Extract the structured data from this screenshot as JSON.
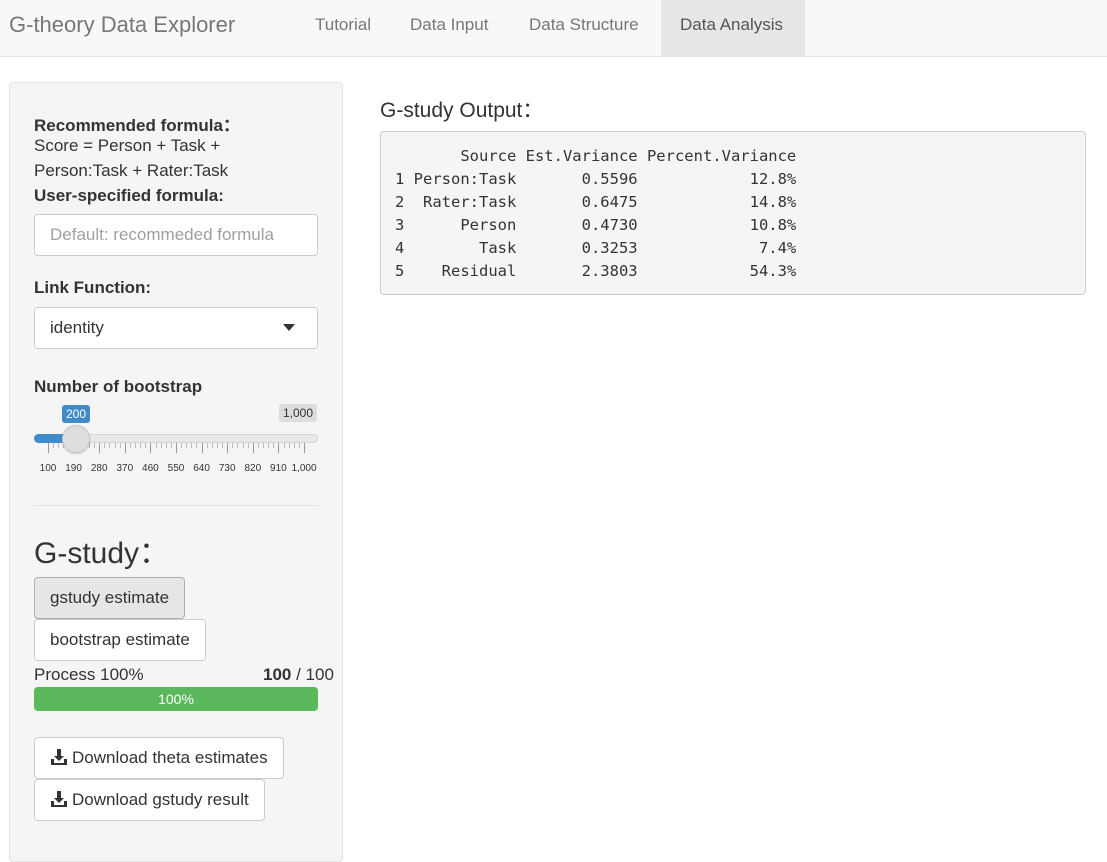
{
  "app": {
    "title": "G-theory Data Explorer"
  },
  "nav": {
    "tabs": [
      {
        "label": "Tutorial"
      },
      {
        "label": "Data Input"
      },
      {
        "label": "Data Structure"
      },
      {
        "label": "Data Analysis",
        "active": true
      }
    ]
  },
  "sidebar": {
    "recommended_label": "Recommended formula：",
    "recommended_line1": "Score = Person + Task +",
    "recommended_line2": "Person:Task + Rater:Task",
    "user_formula_label": "User-specified formula:",
    "user_formula_value": "",
    "user_formula_placeholder": "Default: recommeded formula",
    "link_label": "Link Function:",
    "link_selected": "identity",
    "bootstrap_label": "Number of bootstrap",
    "bootstrap_value": "200",
    "bootstrap_max": "1,000",
    "bootstrap_ticks": [
      "100",
      "190",
      "280",
      "370",
      "460",
      "550",
      "640",
      "730",
      "820",
      "910",
      "1,000"
    ],
    "gstudy_heading": "G-study：",
    "gstudy_button": "gstudy estimate",
    "bootstrap_button": "bootstrap estimate",
    "process_label": "Process 100%",
    "process_count": "100",
    "process_total": "/ 100",
    "progress_percent": 100,
    "progress_text": "100%",
    "download_theta": "Download theta estimates",
    "download_gstudy": "Download gstudy result"
  },
  "main": {
    "title": "G-study Output：",
    "table_header": "       Source Est.Variance Percent.Variance",
    "table_rows": [
      "1 Person:Task       0.5596            12.8%",
      "2  Rater:Task       0.6475            14.8%",
      "3      Person       0.4730            10.8%",
      "4        Task       0.3253             7.4%",
      "5    Residual       2.3803            54.3%"
    ]
  },
  "colors": {
    "accent": "#428bca",
    "progress": "#5cb85c"
  }
}
